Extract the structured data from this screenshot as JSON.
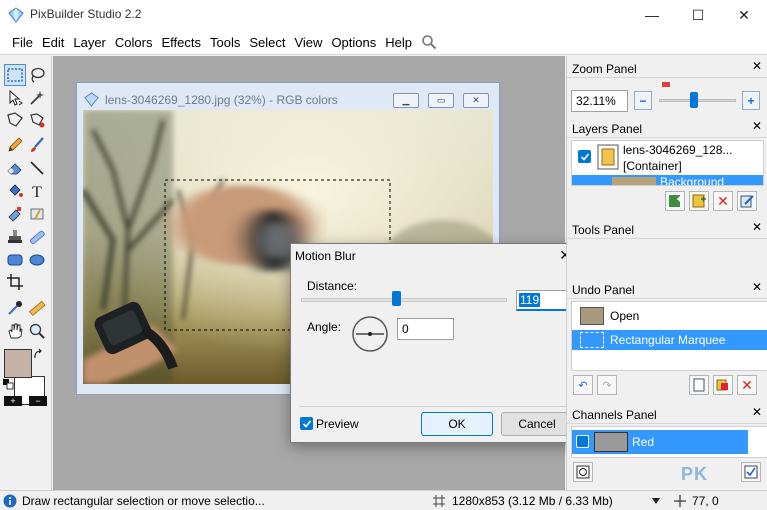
{
  "window": {
    "title": "PixBuilder Studio 2.2",
    "minimize": "—",
    "maximize": "☐",
    "close": "✕"
  },
  "menu": [
    "File",
    "Edit",
    "Layer",
    "Colors",
    "Effects",
    "Tools",
    "Select",
    "View",
    "Options",
    "Help"
  ],
  "image_window": {
    "title": "lens-3046269_1280.jpg (32%) - RGB colors"
  },
  "dialog": {
    "title": "Motion Blur",
    "distance_label": "Distance:",
    "distance_value": "119",
    "distance_fraction": 0.46,
    "angle_label": "Angle:",
    "angle_value": "0",
    "preview_label": "Preview",
    "preview_checked": true,
    "ok_label": "OK",
    "cancel_label": "Cancel"
  },
  "zoom_panel": {
    "title": "Zoom Panel",
    "value": "32.11%",
    "minus": "−",
    "plus": "+",
    "slider_fraction": 0.46
  },
  "layers_panel": {
    "title": "Layers Panel",
    "layer_name": "lens-3046269_128...",
    "layer_type": "[Container]",
    "sublayer": "Background"
  },
  "tools_panel": {
    "title": "Tools Panel"
  },
  "undo_panel": {
    "title": "Undo Panel",
    "items": [
      "Open",
      "Rectangular Marquee"
    ]
  },
  "channels_panel": {
    "title": "Channels Panel",
    "items": [
      "Red"
    ]
  },
  "status": {
    "hint": "Draw rectangular selection or move selectio...",
    "image_info": "1280x853  (3.12 Mb / 6.33 Mb)",
    "coords": "77, 0"
  },
  "watermark": "PK",
  "colors": {
    "accent": "#0078d7",
    "selection": "#3399ff",
    "foreground_swatch": "#c4b3a6",
    "background_swatch": "#ffffff"
  }
}
